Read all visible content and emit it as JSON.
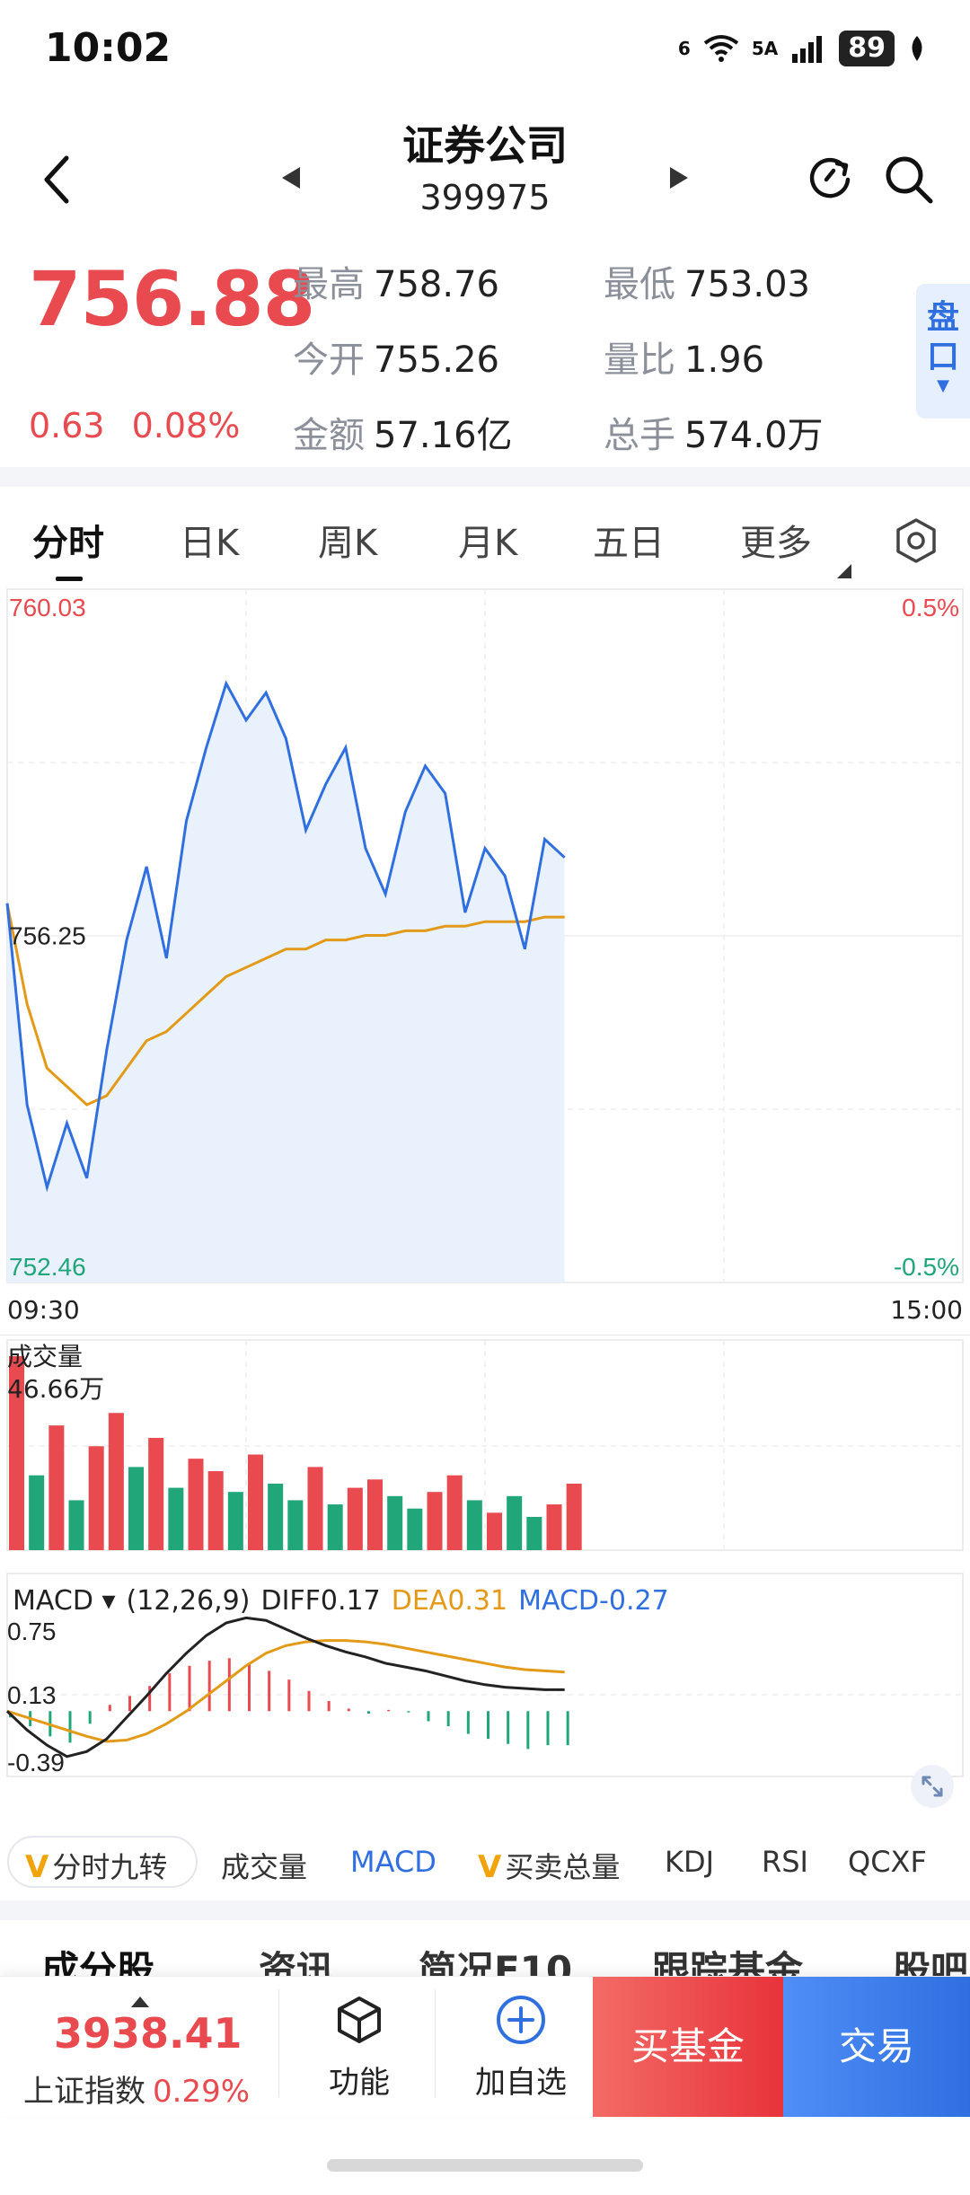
{
  "status": {
    "time": "10:02",
    "battery": "89",
    "wifi_label": "6",
    "signal_label": "5A"
  },
  "header": {
    "title": "证券公司",
    "code": "399975"
  },
  "quote": {
    "price": "756.88",
    "change_abs": "0.63",
    "change_pct": "0.08%",
    "high_label": "最高",
    "high": "758.76",
    "low_label": "最低",
    "low": "753.03",
    "open_label": "今开",
    "open": "755.26",
    "vol_ratio_label": "量比",
    "vol_ratio": "1.96",
    "amount_label": "金额",
    "amount": "57.16亿",
    "total_hands_label": "总手",
    "total_hands": "574.0万",
    "side_tab": "盘口"
  },
  "tabs": [
    "分时",
    "日K",
    "周K",
    "月K",
    "五日",
    "更多"
  ],
  "chart_data": [
    {
      "type": "line",
      "title": "",
      "series": [
        {
          "values": [
            756.6,
            754.4,
            753.5,
            754.2,
            753.6,
            755.0,
            756.2,
            757.0,
            756.0,
            757.5,
            758.3,
            759.0,
            758.6,
            758.9,
            758.4,
            757.4,
            757.9,
            758.3,
            757.2,
            756.7,
            757.6,
            758.1,
            757.8,
            756.5,
            757.2,
            756.9,
            756.1,
            757.3,
            757.1
          ]
        },
        {
          "values": [
            756.6,
            755.5,
            754.8,
            754.6,
            754.4,
            754.5,
            754.8,
            755.1,
            755.2,
            755.4,
            755.6,
            755.8,
            755.9,
            756.0,
            756.1,
            756.1,
            756.2,
            756.2,
            756.25,
            756.25,
            756.3,
            756.3,
            756.35,
            756.35,
            756.4,
            756.4,
            756.4,
            756.45,
            756.45
          ]
        }
      ],
      "ylim": [
        752.46,
        760.03
      ],
      "y_tick_labels": [
        "760.03",
        "756.25",
        "752.46"
      ],
      "right_labels": [
        "0.5%",
        "-0.5%"
      ],
      "x_tick_labels": [
        "09:30",
        "15:00"
      ]
    },
    {
      "type": "bar",
      "title": "成交量",
      "max_label": "46.66万",
      "values": [
        46.66,
        18,
        30,
        12,
        25,
        33,
        20,
        27,
        15,
        22,
        19,
        14,
        23,
        16,
        12,
        20,
        11,
        15,
        17,
        13,
        10,
        14,
        18,
        12,
        9,
        13,
        8,
        11,
        16
      ],
      "up": [
        true,
        false,
        true,
        false,
        true,
        true,
        false,
        true,
        false,
        true,
        true,
        false,
        true,
        false,
        false,
        true,
        false,
        true,
        true,
        false,
        false,
        true,
        true,
        false,
        true,
        false,
        false,
        true,
        true
      ],
      "ylim": [
        0,
        46.66
      ]
    },
    {
      "type": "line",
      "title": "MACD",
      "params": "(12,26,9)",
      "diff_label": "DIFF0.17",
      "dea_label": "DEA0.31",
      "macd_label": "MACD-0.27",
      "y_tick_labels": [
        "0.75",
        "0.13",
        "-0.39"
      ],
      "ylim": [
        -0.39,
        0.75
      ],
      "histogram": [
        -0.05,
        -0.12,
        -0.2,
        -0.25,
        -0.1,
        0.05,
        0.12,
        0.2,
        0.3,
        0.36,
        0.4,
        0.42,
        0.38,
        0.32,
        0.25,
        0.16,
        0.08,
        0.02,
        -0.02,
        0.01,
        -0.01,
        -0.08,
        -0.12,
        -0.18,
        -0.22,
        -0.26,
        -0.3,
        -0.27,
        -0.27
      ],
      "diff": [
        0.0,
        -0.15,
        -0.27,
        -0.36,
        -0.32,
        -0.22,
        -0.05,
        0.12,
        0.3,
        0.46,
        0.6,
        0.7,
        0.74,
        0.72,
        0.65,
        0.58,
        0.52,
        0.47,
        0.43,
        0.38,
        0.35,
        0.32,
        0.28,
        0.24,
        0.21,
        0.19,
        0.18,
        0.17,
        0.17
      ],
      "dea": [
        0.0,
        -0.05,
        -0.1,
        -0.15,
        -0.2,
        -0.24,
        -0.23,
        -0.18,
        -0.1,
        0.0,
        0.12,
        0.24,
        0.36,
        0.46,
        0.52,
        0.55,
        0.56,
        0.56,
        0.55,
        0.53,
        0.5,
        0.47,
        0.44,
        0.41,
        0.38,
        0.35,
        0.33,
        0.32,
        0.31
      ]
    }
  ],
  "indicators": {
    "items": [
      "分时九转",
      "成交量",
      "MACD",
      "买卖总量",
      "KDJ",
      "RSI",
      "QCXF"
    ]
  },
  "sections": [
    "成分股",
    "资讯",
    "简况F10",
    "跟踪基金",
    "股吧"
  ],
  "bottom": {
    "index_price": "3938.41",
    "index_name": "上证指数",
    "index_pct": "0.29%",
    "func_label": "功能",
    "add_label": "加自选",
    "buy_fund": "买基金",
    "trade": "交易"
  },
  "colors": {
    "up": "#e84a4f",
    "down": "#21a67a",
    "price_line": "#2f6fe0",
    "avg_line": "#e39a18",
    "accent": "#2f6fe0"
  }
}
